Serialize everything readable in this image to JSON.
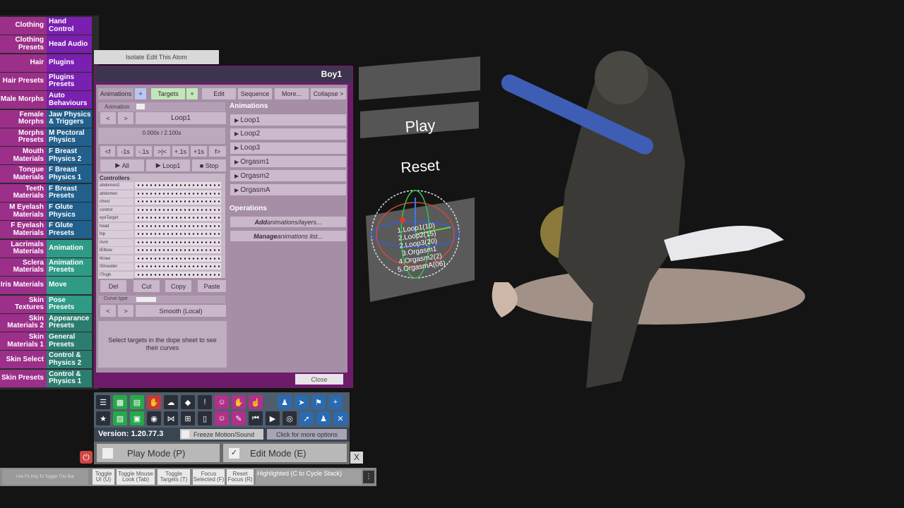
{
  "left_tabs": [
    {
      "left": "Clothing",
      "right": "Hand Control"
    },
    {
      "left": "Clothing Presets",
      "right": "Head Audio"
    },
    {
      "left": "Hair",
      "right": "Plugins"
    },
    {
      "left": "Hair Presets",
      "right": "Plugins Presets"
    },
    {
      "left": "Male Morphs",
      "right": "Auto Behaviours"
    },
    {
      "left": "Female Morphs",
      "right": "Jaw Physics & Triggers"
    },
    {
      "left": "Morphs Presets",
      "right": "M Pectoral Physics"
    },
    {
      "left": "Mouth Materials",
      "right": "F Breast Physics 2"
    },
    {
      "left": "Tongue Materials",
      "right": "F Breast Physics 1"
    },
    {
      "left": "Teeth Materials",
      "right": "F Breast Presets"
    },
    {
      "left": "M Eyelash Materials",
      "right": "F Glute Physics"
    },
    {
      "left": "F Eyelash Materials",
      "right": "F Glute Presets"
    },
    {
      "left": "Lacrimals Materials",
      "right": "Animation"
    },
    {
      "left": "Sclera Materials",
      "right": "Animation Presets"
    },
    {
      "left": "Iris Materials",
      "right": "Move"
    },
    {
      "left": "Skin Textures",
      "right": "Pose Presets"
    },
    {
      "left": "Skin Materials 2",
      "right": "Appearance Presets"
    },
    {
      "left": "Skin Materials 1",
      "right": "General Presets"
    },
    {
      "left": "Skin Select",
      "right": "Control & Physics 2"
    },
    {
      "left": "Skin Presets",
      "right": "Control & Physics 1"
    }
  ],
  "isolate_button": "Isolate Edit This Atom",
  "panel": {
    "title": "Boy1",
    "toolbar": {
      "animations": "Animations",
      "plus1": "+",
      "targets": "Targets",
      "plus2": "+",
      "edit": "Edit",
      "sequence": "Sequence",
      "more": "More...",
      "collapse": "Collapse >"
    },
    "animation_label": "Animation",
    "prev": "<",
    "next": ">",
    "animation_name": "Loop1",
    "time": "0.000s / 2.100s",
    "scrub": {
      "f1": "<f",
      "m1": "-1s",
      "m01": "-.1s",
      "snap": ">|<",
      "p01": "+.1s",
      "p1": "+1s",
      "f2": "f>"
    },
    "play_all": "All",
    "play_loop": "Loop1",
    "stop": "Stop",
    "controllers_label": "Controllers",
    "controllers": [
      "abdomen2",
      "abdomen",
      "chest",
      "control",
      "eyeTarget",
      "head",
      "hip",
      "lArm",
      "lElbow",
      "lKnee",
      "lShoulder",
      "lThigh"
    ],
    "edit_buttons": {
      "del": "Del",
      "cut": "Cut",
      "copy": "Copy",
      "paste": "Paste"
    },
    "curve_type_label": "Curve type",
    "curve_type": "Smooth (Local)",
    "hint": "Select targets in the dope sheet to see their curves",
    "animations_header": "Animations",
    "animations": [
      "Loop1",
      "Loop2",
      "Loop3",
      "Orgasm1",
      "Orgasm2",
      "OrgasmA"
    ],
    "operations_header": "Operations",
    "op_add_em": "Add",
    "op_add_rest": " animations/layers...",
    "op_manage_em": "Manage",
    "op_manage_rest": " animations list...",
    "close": "Close"
  },
  "bottom": {
    "version": "Version: 1.20.77.3",
    "freeze": "Freeze Motion/Sound",
    "more_options": "Click for more options",
    "play_mode": "Play Mode (P)",
    "edit_mode": "Edit Mode (E)",
    "close_x": "X"
  },
  "hud": {
    "f1": "Use F1 Key To Toggle This Bar",
    "toggle_ui": "Toggle UI (U)",
    "toggle_mouse": "Toggle Mouse Look (Tab)",
    "toggle_targets": "Toggle Targets (T)",
    "focus": "Focus Selected (F)",
    "reset_focus": "Reset Focus (R)",
    "highlighted": "Highlighted (C to Cycle Stack)"
  },
  "scene": {
    "play": "Play",
    "reset": "Reset",
    "gizmo_lines": [
      "1.Loop1(10)",
      "2.Loop2(15)",
      "2.Loop3(20)",
      "3.Orgasm1",
      "4.Orgasm2(2)",
      "5.OrgasmA(06)"
    ]
  },
  "colors": {
    "tab_left": "#9c2f8a",
    "tab_purple": "#7a1fb0",
    "tab_blue": "#215f8c",
    "tab_teal": "#2b8a7c",
    "panel_bg": "#6d1c6a"
  }
}
